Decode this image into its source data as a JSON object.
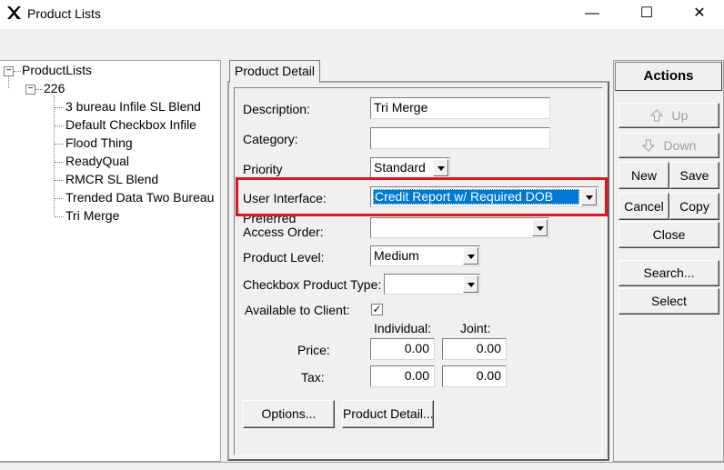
{
  "window": {
    "title": "Product Lists",
    "minimize": "—",
    "maximize": "☐",
    "close": "✕"
  },
  "tree": {
    "root": "ProductLists",
    "group": "226",
    "items": [
      "3 bureau Infile SL Blend",
      "Default Checkbox Infile",
      "Flood Thing",
      "ReadyQual",
      "RMCR SL Blend",
      "Trended Data Two Bureau",
      "Tri Merge"
    ]
  },
  "tab": {
    "label": "Product Detail"
  },
  "form": {
    "description_label": "Description:",
    "description_value": "Tri Merge",
    "category_label": "Category:",
    "category_value": "",
    "priority_label": "Priority",
    "priority_value": "Standard",
    "user_interface_label": "User Interface:",
    "user_interface_value": "Credit Report w/ Required DOB",
    "preferred_label_1": "Preferred",
    "preferred_label_2": "Access Order:",
    "preferred_value": "",
    "product_level_label": "Product Level:",
    "product_level_value": "Medium",
    "checkbox_type_label": "Checkbox Product Type:",
    "checkbox_type_value": "",
    "available_label": "Available to Client:",
    "available_checked": "✓",
    "individual_header": "Individual:",
    "joint_header": "Joint:",
    "price_label": "Price:",
    "price_individual": "0.00",
    "price_joint": "0.00",
    "tax_label": "Tax:",
    "tax_individual": "0.00",
    "tax_joint": "0.00",
    "options_button": "Options...",
    "product_detail_button": "Product Detail..."
  },
  "actions": {
    "header": "Actions",
    "up": "Up",
    "down": "Down",
    "new": "New",
    "save": "Save",
    "cancel": "Cancel",
    "copy": "Copy",
    "close": "Close",
    "search": "Search...",
    "select": "Select"
  },
  "colors": {
    "highlight_border": "#e0141c",
    "selection_bg": "#0078d7"
  }
}
